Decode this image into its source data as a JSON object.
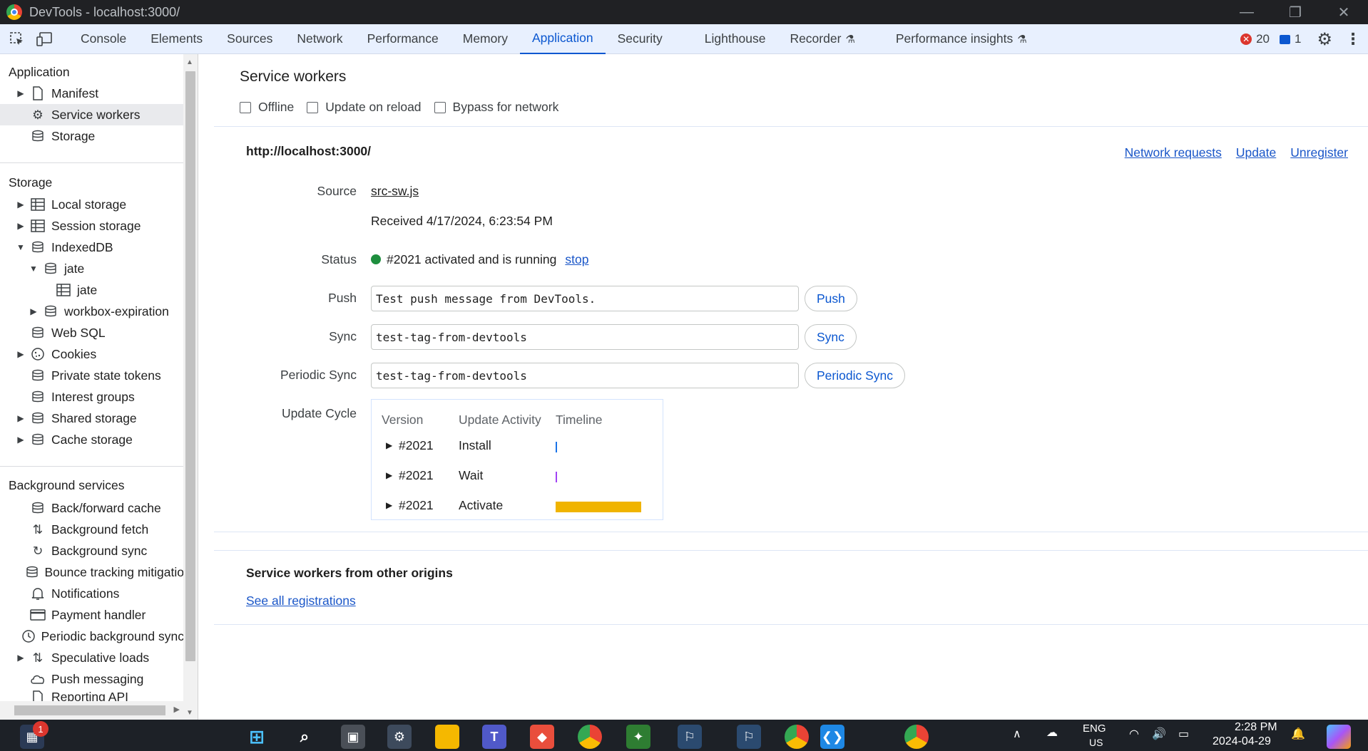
{
  "window": {
    "title": "DevTools - localhost:3000/"
  },
  "toolbar": {
    "tabs": [
      {
        "label": "Console"
      },
      {
        "label": "Elements"
      },
      {
        "label": "Sources"
      },
      {
        "label": "Network"
      },
      {
        "label": "Performance"
      },
      {
        "label": "Memory"
      },
      {
        "label": "Application"
      },
      {
        "label": "Security"
      },
      {
        "label": "Lighthouse"
      },
      {
        "label": "Recorder"
      },
      {
        "label": "Performance insights"
      }
    ],
    "active_tab": "Application",
    "error_count": "20",
    "message_count": "1"
  },
  "sidebar": {
    "application": {
      "heading": "Application",
      "items": [
        "Manifest",
        "Service workers",
        "Storage"
      ]
    },
    "storage": {
      "heading": "Storage",
      "items": [
        "Local storage",
        "Session storage",
        "IndexedDB",
        "jate",
        "jate",
        "workbox-expiration",
        "Web SQL",
        "Cookies",
        "Private state tokens",
        "Interest groups",
        "Shared storage",
        "Cache storage"
      ]
    },
    "background": {
      "heading": "Background services",
      "items": [
        "Back/forward cache",
        "Background fetch",
        "Background sync",
        "Bounce tracking mitigatio",
        "Notifications",
        "Payment handler",
        "Periodic background sync",
        "Speculative loads",
        "Push messaging",
        "Reporting API"
      ]
    }
  },
  "main": {
    "title": "Service workers",
    "checkboxes": [
      "Offline",
      "Update on reload",
      "Bypass for network"
    ],
    "origin": "http://localhost:3000/",
    "origin_links": [
      "Network requests",
      "Update",
      "Unregister"
    ],
    "source_label": "Source",
    "source_link": "src-sw.js",
    "received": "Received 4/17/2024, 6:23:54 PM",
    "status_label": "Status",
    "status_text": "#2021 activated and is running",
    "status_stop": "stop",
    "push_label": "Push",
    "push_value": "Test push message from DevTools.",
    "push_button": "Push",
    "sync_label": "Sync",
    "sync_value": "test-tag-from-devtools",
    "sync_button": "Sync",
    "periodic_label": "Periodic Sync",
    "periodic_value": "test-tag-from-devtools",
    "periodic_button": "Periodic Sync",
    "cycle_label": "Update Cycle",
    "cycle": {
      "headers": [
        "Version",
        "Update Activity",
        "Timeline"
      ],
      "rows": [
        {
          "version": "#2021",
          "activity": "Install",
          "color": "#1a73e8",
          "duration": 0.02
        },
        {
          "version": "#2021",
          "activity": "Wait",
          "color": "#a142f4",
          "duration": 0.02
        },
        {
          "version": "#2021",
          "activity": "Activate",
          "color": "#f0b400",
          "duration": 1.0
        }
      ]
    },
    "other_title": "Service workers from other origins",
    "other_link": "See all registrations"
  },
  "taskbar": {
    "notification_count": "1",
    "lang": "ENG",
    "lang_sub": "US",
    "time": "2:28 PM",
    "date": "2024-04-29"
  },
  "colors": {
    "accent": "#0b57d0",
    "link": "#1a56c8",
    "running": "#1e8e3e",
    "error": "#dc362e"
  }
}
